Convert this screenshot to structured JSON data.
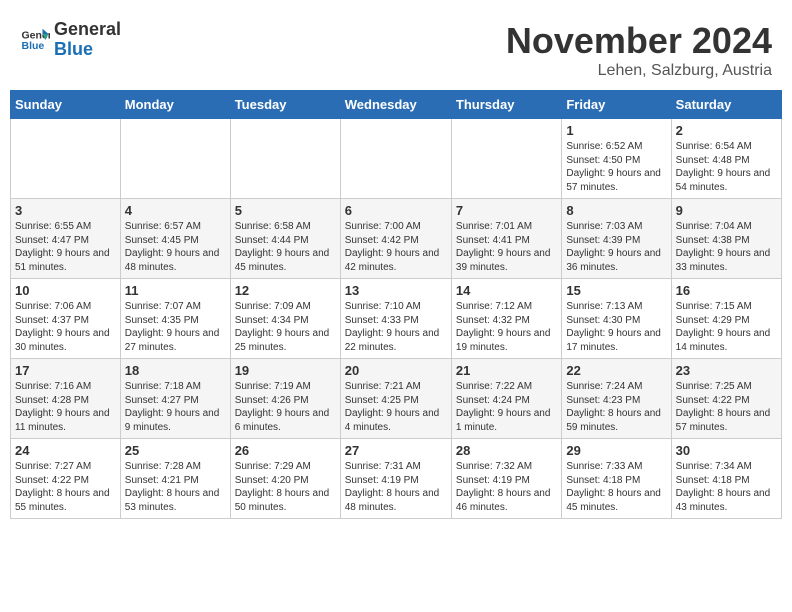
{
  "logo": {
    "general": "General",
    "blue": "Blue"
  },
  "title": {
    "month": "November 2024",
    "location": "Lehen, Salzburg, Austria"
  },
  "headers": [
    "Sunday",
    "Monday",
    "Tuesday",
    "Wednesday",
    "Thursday",
    "Friday",
    "Saturday"
  ],
  "weeks": [
    [
      {
        "day": "",
        "info": ""
      },
      {
        "day": "",
        "info": ""
      },
      {
        "day": "",
        "info": ""
      },
      {
        "day": "",
        "info": ""
      },
      {
        "day": "",
        "info": ""
      },
      {
        "day": "1",
        "info": "Sunrise: 6:52 AM\nSunset: 4:50 PM\nDaylight: 9 hours and 57 minutes."
      },
      {
        "day": "2",
        "info": "Sunrise: 6:54 AM\nSunset: 4:48 PM\nDaylight: 9 hours and 54 minutes."
      }
    ],
    [
      {
        "day": "3",
        "info": "Sunrise: 6:55 AM\nSunset: 4:47 PM\nDaylight: 9 hours and 51 minutes."
      },
      {
        "day": "4",
        "info": "Sunrise: 6:57 AM\nSunset: 4:45 PM\nDaylight: 9 hours and 48 minutes."
      },
      {
        "day": "5",
        "info": "Sunrise: 6:58 AM\nSunset: 4:44 PM\nDaylight: 9 hours and 45 minutes."
      },
      {
        "day": "6",
        "info": "Sunrise: 7:00 AM\nSunset: 4:42 PM\nDaylight: 9 hours and 42 minutes."
      },
      {
        "day": "7",
        "info": "Sunrise: 7:01 AM\nSunset: 4:41 PM\nDaylight: 9 hours and 39 minutes."
      },
      {
        "day": "8",
        "info": "Sunrise: 7:03 AM\nSunset: 4:39 PM\nDaylight: 9 hours and 36 minutes."
      },
      {
        "day": "9",
        "info": "Sunrise: 7:04 AM\nSunset: 4:38 PM\nDaylight: 9 hours and 33 minutes."
      }
    ],
    [
      {
        "day": "10",
        "info": "Sunrise: 7:06 AM\nSunset: 4:37 PM\nDaylight: 9 hours and 30 minutes."
      },
      {
        "day": "11",
        "info": "Sunrise: 7:07 AM\nSunset: 4:35 PM\nDaylight: 9 hours and 27 minutes."
      },
      {
        "day": "12",
        "info": "Sunrise: 7:09 AM\nSunset: 4:34 PM\nDaylight: 9 hours and 25 minutes."
      },
      {
        "day": "13",
        "info": "Sunrise: 7:10 AM\nSunset: 4:33 PM\nDaylight: 9 hours and 22 minutes."
      },
      {
        "day": "14",
        "info": "Sunrise: 7:12 AM\nSunset: 4:32 PM\nDaylight: 9 hours and 19 minutes."
      },
      {
        "day": "15",
        "info": "Sunrise: 7:13 AM\nSunset: 4:30 PM\nDaylight: 9 hours and 17 minutes."
      },
      {
        "day": "16",
        "info": "Sunrise: 7:15 AM\nSunset: 4:29 PM\nDaylight: 9 hours and 14 minutes."
      }
    ],
    [
      {
        "day": "17",
        "info": "Sunrise: 7:16 AM\nSunset: 4:28 PM\nDaylight: 9 hours and 11 minutes."
      },
      {
        "day": "18",
        "info": "Sunrise: 7:18 AM\nSunset: 4:27 PM\nDaylight: 9 hours and 9 minutes."
      },
      {
        "day": "19",
        "info": "Sunrise: 7:19 AM\nSunset: 4:26 PM\nDaylight: 9 hours and 6 minutes."
      },
      {
        "day": "20",
        "info": "Sunrise: 7:21 AM\nSunset: 4:25 PM\nDaylight: 9 hours and 4 minutes."
      },
      {
        "day": "21",
        "info": "Sunrise: 7:22 AM\nSunset: 4:24 PM\nDaylight: 9 hours and 1 minute."
      },
      {
        "day": "22",
        "info": "Sunrise: 7:24 AM\nSunset: 4:23 PM\nDaylight: 8 hours and 59 minutes."
      },
      {
        "day": "23",
        "info": "Sunrise: 7:25 AM\nSunset: 4:22 PM\nDaylight: 8 hours and 57 minutes."
      }
    ],
    [
      {
        "day": "24",
        "info": "Sunrise: 7:27 AM\nSunset: 4:22 PM\nDaylight: 8 hours and 55 minutes."
      },
      {
        "day": "25",
        "info": "Sunrise: 7:28 AM\nSunset: 4:21 PM\nDaylight: 8 hours and 53 minutes."
      },
      {
        "day": "26",
        "info": "Sunrise: 7:29 AM\nSunset: 4:20 PM\nDaylight: 8 hours and 50 minutes."
      },
      {
        "day": "27",
        "info": "Sunrise: 7:31 AM\nSunset: 4:19 PM\nDaylight: 8 hours and 48 minutes."
      },
      {
        "day": "28",
        "info": "Sunrise: 7:32 AM\nSunset: 4:19 PM\nDaylight: 8 hours and 46 minutes."
      },
      {
        "day": "29",
        "info": "Sunrise: 7:33 AM\nSunset: 4:18 PM\nDaylight: 8 hours and 45 minutes."
      },
      {
        "day": "30",
        "info": "Sunrise: 7:34 AM\nSunset: 4:18 PM\nDaylight: 8 hours and 43 minutes."
      }
    ]
  ]
}
